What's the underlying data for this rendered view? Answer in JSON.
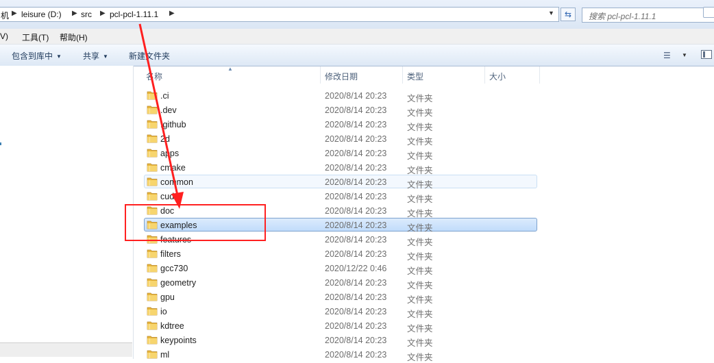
{
  "address_bar": {
    "crumbs": [
      "机",
      "leisure (D:)",
      "src",
      "pcl-pcl-1.11.1"
    ],
    "search_placeholder": "搜索 pcl-pcl-1.11.1"
  },
  "menu": {
    "items": [
      "V)",
      "工具(T)",
      "帮助(H)"
    ]
  },
  "toolbar": {
    "include_label": "包含到库中",
    "share_label": "共享",
    "new_folder_label": "新建文件夹",
    "view_icon": "view-options-icon",
    "pane_icon": "preview-pane-icon"
  },
  "columns": {
    "name": "名称",
    "date": "修改日期",
    "type": "类型",
    "size": "大小"
  },
  "files": [
    {
      "name": ".ci",
      "date": "2020/8/14 20:23",
      "type": "文件夹",
      "state": ""
    },
    {
      "name": ".dev",
      "date": "2020/8/14 20:23",
      "type": "文件夹",
      "state": ""
    },
    {
      "name": ".github",
      "date": "2020/8/14 20:23",
      "type": "文件夹",
      "state": ""
    },
    {
      "name": "2d",
      "date": "2020/8/14 20:23",
      "type": "文件夹",
      "state": ""
    },
    {
      "name": "apps",
      "date": "2020/8/14 20:23",
      "type": "文件夹",
      "state": ""
    },
    {
      "name": "cmake",
      "date": "2020/8/14 20:23",
      "type": "文件夹",
      "state": ""
    },
    {
      "name": "common",
      "date": "2020/8/14 20:23",
      "type": "文件夹",
      "state": "hover"
    },
    {
      "name": "cuda",
      "date": "2020/8/14 20:23",
      "type": "文件夹",
      "state": ""
    },
    {
      "name": "doc",
      "date": "2020/8/14 20:23",
      "type": "文件夹",
      "state": ""
    },
    {
      "name": "examples",
      "date": "2020/8/14 20:23",
      "type": "文件夹",
      "state": "selected"
    },
    {
      "name": "features",
      "date": "2020/8/14 20:23",
      "type": "文件夹",
      "state": ""
    },
    {
      "name": "filters",
      "date": "2020/8/14 20:23",
      "type": "文件夹",
      "state": ""
    },
    {
      "name": "gcc730",
      "date": "2020/12/22 0:46",
      "type": "文件夹",
      "state": ""
    },
    {
      "name": "geometry",
      "date": "2020/8/14 20:23",
      "type": "文件夹",
      "state": ""
    },
    {
      "name": "gpu",
      "date": "2020/8/14 20:23",
      "type": "文件夹",
      "state": ""
    },
    {
      "name": "io",
      "date": "2020/8/14 20:23",
      "type": "文件夹",
      "state": ""
    },
    {
      "name": "kdtree",
      "date": "2020/8/14 20:23",
      "type": "文件夹",
      "state": ""
    },
    {
      "name": "keypoints",
      "date": "2020/8/14 20:23",
      "type": "文件夹",
      "state": ""
    },
    {
      "name": "ml",
      "date": "2020/8/14 20:23",
      "type": "文件夹",
      "state": ""
    }
  ],
  "annotation": {
    "color": "#ff2020"
  }
}
